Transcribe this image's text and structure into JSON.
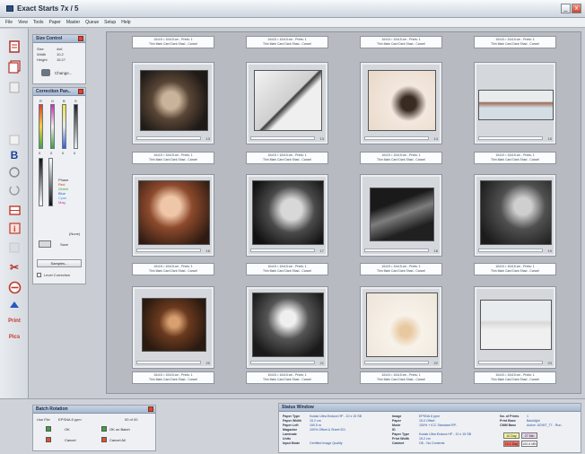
{
  "window": {
    "title": "Exact Starts 7x / 5",
    "min_label": "_",
    "close_label": "x"
  },
  "menu": [
    "File",
    "View",
    "Tools",
    "Paper",
    "Master",
    "Queue",
    "Setup",
    "Help"
  ],
  "toolbar_icons": [
    "page-icon",
    "pages-icon",
    "copy-icon",
    "paste-icon",
    "bold-b-icon",
    "rotate-left-icon",
    "rotate-right-icon",
    "crop-icon",
    "info-icon",
    "blank-icon",
    "scissors-icon",
    "no-entry-icon",
    "send-print-icon",
    "print-page-icon",
    "print-plus-icon"
  ],
  "toolbar_labels": {
    "bold": "B",
    "info": "i",
    "scissors": "✂",
    "print_a": "Print",
    "print_b": "Pics"
  },
  "size_control": {
    "title": "Size Control",
    "rows": [
      {
        "label": "Size",
        "value": "4x6"
      },
      {
        "label": "Width",
        "value": "10.2"
      },
      {
        "label": "Height",
        "value": "15.27"
      }
    ],
    "change_label": "Change..."
  },
  "color_panel": {
    "title": "Correction Pan..",
    "channels": [
      "R",
      "G",
      "B",
      "S"
    ],
    "bottom_values": [
      "0",
      "0",
      "0",
      "0"
    ],
    "legend": [
      "Phase",
      "Red",
      "Green",
      "Blue",
      "Cyan",
      "Mag"
    ],
    "legend_colors": [
      "#333333",
      "#d23b2a",
      "#2f9b3a",
      "#2b58c9",
      "#2fa7c6",
      "#c9339a"
    ],
    "adjust_label": "(None)",
    "save_label": "Save",
    "samples_label": "Samples...",
    "checkbox_label": "Level Correction"
  },
  "thumbnails": [
    {
      "num": "1",
      "cap1": "10x15 = 10x15 cm - Prints: 1",
      "cap2": "Thin Mark Card Dark Shad - Cancel"
    },
    {
      "num": "2",
      "cap1": "10x15 = 10x15 cm - Prints: 1",
      "cap2": "Thin Mark Card Dark Shad - Cancel"
    },
    {
      "num": "3",
      "cap1": "10x15 = 10x15 cm - Prints: 1",
      "cap2": "Thin Mark Card Dark Shad - Cancel"
    },
    {
      "num": "4",
      "cap1": "10x15 = 10x15 cm - Prints: 1",
      "cap2": "Thin Mark Card Dark Shad - Cancel"
    },
    {
      "num": "13",
      "cap1": "10x15 = 10x15 cm - Prints: 1",
      "cap2": "Thin Mark Card Dark Shad - Cancel"
    },
    {
      "num": "13",
      "cap1": "10x15 = 10x15 cm - Prints: 1",
      "cap2": "Thin Mark Card Dark Shad - Cancel"
    },
    {
      "num": "14",
      "cap1": "10x15 = 10x15 cm - Prints: 1",
      "cap2": "Thin Mark Card Dark Shad - Cancel"
    },
    {
      "num": "15",
      "cap1": "10x15 = 10x15 cm - Prints: 1",
      "cap2": "Thin Mark Card Dark Shad - Cancel"
    },
    {
      "num": "16",
      "cap1": "10x15 = 10x15 cm - Prints: 1",
      "cap2": "Thin Mark Card Dark Shad - Cancel"
    },
    {
      "num": "17",
      "cap1": "10x15 = 10x15 cm - Prints: 1",
      "cap2": "Thin Mark Card Dark Shad - Cancel"
    },
    {
      "num": "18",
      "cap1": "10x15 = 10x15 cm - Prints: 1",
      "cap2": "Thin Mark Card Dark Shad - Cancel"
    },
    {
      "num": "19",
      "cap1": "10x15 = 10x15 cm - Prints: 1",
      "cap2": "Thin Mark Card Dark Shad - Cancel"
    },
    {
      "num": "20",
      "cap1": "10x15 = 10x15 cm - Prints: 1",
      "cap2": "Thin Mark Card Dark Shad - Cancel"
    },
    {
      "num": "21",
      "cap1": "10x15 = 10x15 cm - Prints: 1",
      "cap2": "Thin Mark Card Dark Shad - Cancel"
    },
    {
      "num": "22",
      "cap1": "10x15 = 10x15 cm - Prints: 1",
      "cap2": "Thin Mark Card Dark Shad - Cancel"
    },
    {
      "num": "23",
      "cap1": "10x15 = 10x15 cm - Prints: 1",
      "cap2": "Thin Mark Card Dark Shad - Cancel"
    }
  ],
  "batch_panel": {
    "title": "Batch Rotation",
    "size_label": "Use File",
    "size_value": "EPSNA 8 ppm",
    "count": "00 of 00",
    "ok": "OK",
    "ok_batch": "OK on Batch",
    "cancel": "Cancel",
    "cancel_all": "Cancel All"
  },
  "status_window": {
    "title": "Status Window",
    "col1": [
      [
        "Paper Type",
        "Kodak Ultra Endura HP - 10 x 15 SB"
      ],
      [
        "Paper Width",
        "15.2 cm"
      ],
      [
        "Paper Left",
        "150.5 m"
      ],
      [
        "Magazine",
        "100% Offset & Sheet ID1"
      ],
      [
        "Laminate",
        ""
      ],
      [
        "Units",
        ""
      ],
      [
        "Input Mode",
        "Certified Image Quality"
      ]
    ],
    "col2": [
      [
        "Image",
        "EPSNA 8 ppm"
      ],
      [
        "Paper",
        "15.0 Offset"
      ],
      [
        "Mode",
        "100% + ICC Standard RP.."
      ],
      [
        "ID",
        ""
      ],
      [
        "Paper Type",
        "Kodak Ultra Endura HP - 10 x 15 SB"
      ],
      [
        "Print Width",
        "15.2 cm"
      ],
      [
        "Cabinet",
        "OK - No Contents"
      ]
    ],
    "col3": [
      [
        "No. of Prints",
        "1"
      ],
      [
        "Print Base",
        "Backlight"
      ],
      [
        "CMM Base",
        "Active: UDWT_77 - Run.."
      ]
    ],
    "tags": [
      "10 Day",
      "10.1 Day",
      "27 Min",
      "100.8 MB"
    ],
    "tag_colors": [
      "#f3f59a",
      "#f06a58",
      "#e9d4ec",
      "#ffffff"
    ]
  }
}
